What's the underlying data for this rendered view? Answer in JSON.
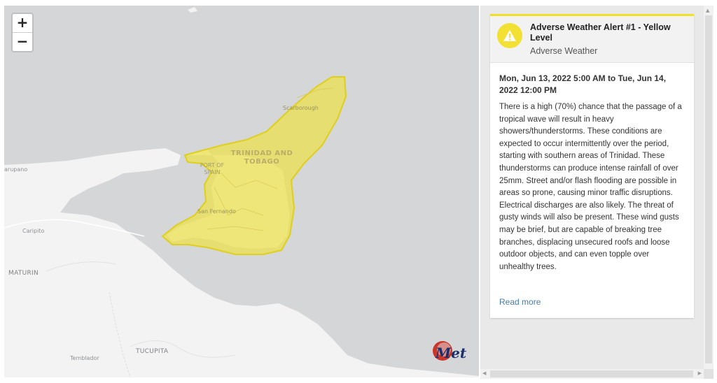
{
  "map": {
    "zoom_in_label": "+",
    "zoom_out_label": "−",
    "labels": {
      "country": "TRINIDAD AND TOBAGO",
      "port_of_spain": "PORT OF SPAIN",
      "san_fernando": "San Fernando",
      "scarborough": "Scarborough",
      "carupano": "arupano",
      "caripito": "Caripito",
      "maturin": "MATURIN",
      "tucupita": "TUCUPITA",
      "temblador": "Temblador"
    },
    "alert_fill_color": "#ede04a",
    "water_color": "#d4d6d8",
    "land_color": "#f3f3f3",
    "logo": {
      "name": "Met logo",
      "text": "Trinidad & Tobago Meteorological Service"
    }
  },
  "alert": {
    "title": "Adverse Weather Alert #1 - Yellow Level",
    "subtitle": "Adverse Weather",
    "level_color": "#f2e033",
    "icon": "warning-icon",
    "dates": "Mon, Jun 13, 2022 5:00 AM to Tue, Jun 14, 2022 12:00 PM",
    "description": "There is a high (70%) chance that the passage of a tropical wave will result in heavy showers/thunderstorms. These conditions are expected to occur intermittently over the period, starting with southern areas of Trinidad. These thunderstorms can produce intense rainfall of over 25mm. Street and/or flash flooding are possible in areas so prone, causing minor traffic disruptions. Electrical discharges are also likely. The threat of gusty winds will also be present. These wind gusts may be brief, but are capable of breaking tree branches, displacing unsecured roofs and loose outdoor objects, and can even topple over unhealthy trees.",
    "read_more": "Read more"
  }
}
